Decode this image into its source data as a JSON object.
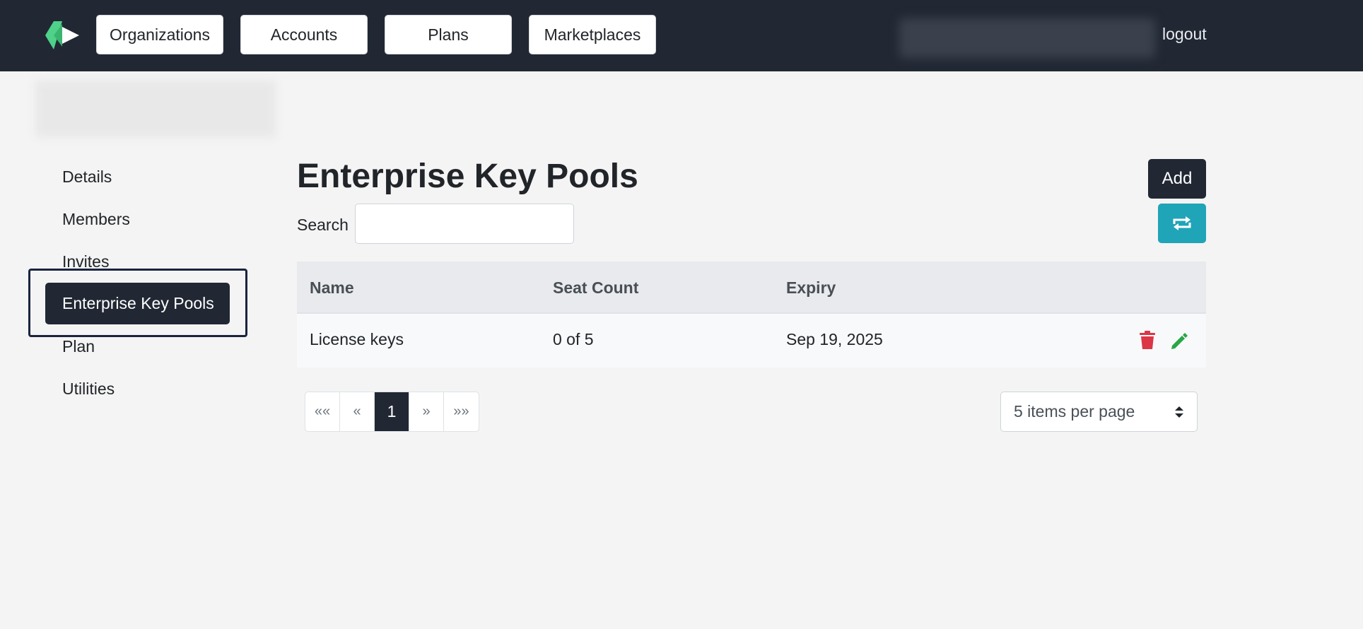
{
  "navbar": {
    "logo": "brand-logo",
    "items": [
      {
        "label": "Organizations"
      },
      {
        "label": "Accounts"
      },
      {
        "label": "Plans"
      },
      {
        "label": "Marketplaces"
      }
    ],
    "logout": "logout"
  },
  "sidebar": {
    "items": [
      {
        "label": "Details"
      },
      {
        "label": "Members"
      },
      {
        "label": "Invites"
      },
      {
        "label": "Enterprise Key Pools",
        "active": true
      },
      {
        "label": "Plan"
      },
      {
        "label": "Utilities"
      }
    ]
  },
  "main": {
    "title": "Enterprise Key Pools",
    "add_label": "Add",
    "search": {
      "label": "Search",
      "value": ""
    },
    "table": {
      "headers": [
        "Name",
        "Seat Count",
        "Expiry"
      ],
      "rows": [
        {
          "name": "License keys",
          "seats": "0 of 5",
          "expiry": "Sep 19, 2025"
        }
      ]
    },
    "pagination": {
      "first": "««",
      "prev": "«",
      "current": "1",
      "next": "»",
      "last": "»»"
    },
    "per_page": "5 items per page"
  },
  "colors": {
    "navbar": "#212834",
    "accent_teal": "#1fa4b8",
    "delete": "#dc3545",
    "edit": "#28a745",
    "logo_green": "#4fd18a"
  },
  "icons": [
    "refresh-icon",
    "trash-icon",
    "pencil-icon",
    "select-arrows-icon"
  ]
}
